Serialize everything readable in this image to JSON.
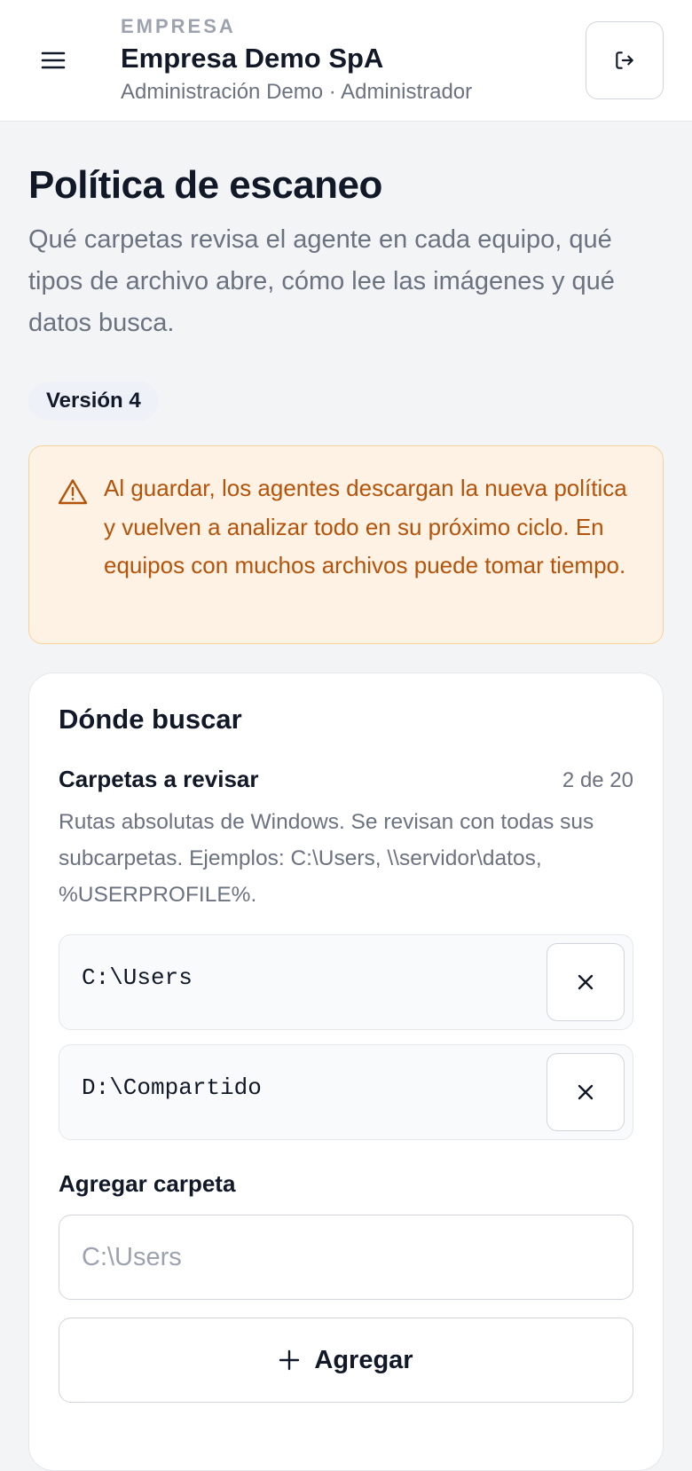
{
  "header": {
    "kicker": "EMPRESA",
    "org_name": "Empresa Demo SpA",
    "subtitle": "Administración Demo · Administrador",
    "menu_icon": "hamburger-menu-icon",
    "logout_icon": "logout-icon"
  },
  "page": {
    "title": "Política de escaneo",
    "description": "Qué carpetas revisa el agente en cada equipo, qué tipos de archivo abre, cómo lee las imágenes y qué datos busca.",
    "version_label": "Versión 4"
  },
  "warning": {
    "icon": "warning-triangle-icon",
    "text": "Al guardar, los agentes descargan la nueva política y vuelven a analizar todo en su próximo ciclo. En equipos con muchos archivos puede tomar tiempo."
  },
  "where_section": {
    "title": "Dónde buscar",
    "folders_label": "Carpetas a revisar",
    "folders_count": "2 de 20",
    "folders_help": "Rutas absolutas de Windows. Se revisan con todas sus subcarpetas. Ejemplos: C:\\Users, \\\\servidor\\datos, %USERPROFILE%.",
    "folders": [
      {
        "path": "C:\\Users"
      },
      {
        "path": "D:\\Compartido"
      }
    ],
    "add_label": "Agregar carpeta",
    "add_placeholder": "C:\\Users",
    "add_button": "Agregar"
  },
  "colors": {
    "warning_bg": "#fdf2e4",
    "warning_border": "#f7d39b",
    "warning_text": "#b45309",
    "text_primary": "#111827",
    "text_muted": "#6b7280"
  }
}
